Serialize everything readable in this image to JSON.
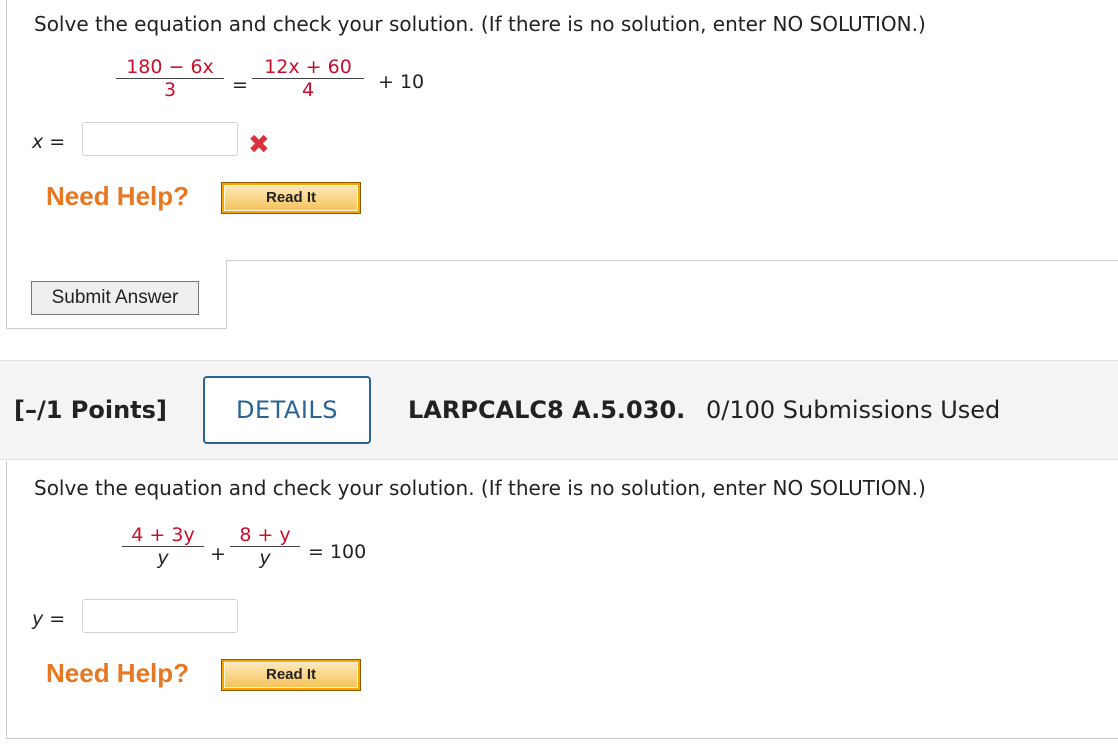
{
  "question1": {
    "prompt": "Solve the equation and check your solution. (If there is no solution, enter NO SOLUTION.)",
    "equation": {
      "left_numerator": "180 − 6x",
      "left_denominator": "3",
      "equals": "=",
      "right_numerator": "12x + 60",
      "right_denominator": "4",
      "right_tail": "+ 10"
    },
    "answer_label": "x =",
    "answer_value": "",
    "status_icon": "x-mark-icon",
    "need_help": "Need Help?",
    "read_it": "Read It",
    "submit": "Submit Answer"
  },
  "question2": {
    "points": "[–/1 Points]",
    "details_button": "DETAILS",
    "question_id": "LARPCALC8 A.5.030.",
    "submissions": "0/100 Submissions Used",
    "prompt": "Solve the equation and check your solution. (If there is no solution, enter NO SOLUTION.)",
    "equation": {
      "frac1_numerator": "4 + 3y",
      "frac1_denominator": "y",
      "plus": "+",
      "frac2_numerator": "8 + y",
      "frac2_denominator": "y",
      "rhs": "= 100"
    },
    "answer_label": "y =",
    "answer_value": "",
    "need_help": "Need Help?",
    "read_it": "Read It"
  },
  "colors": {
    "red_math": "#c8102e",
    "need_help_orange": "#e87722",
    "details_blue": "#2a6496",
    "wrong_red": "#d9333f"
  }
}
